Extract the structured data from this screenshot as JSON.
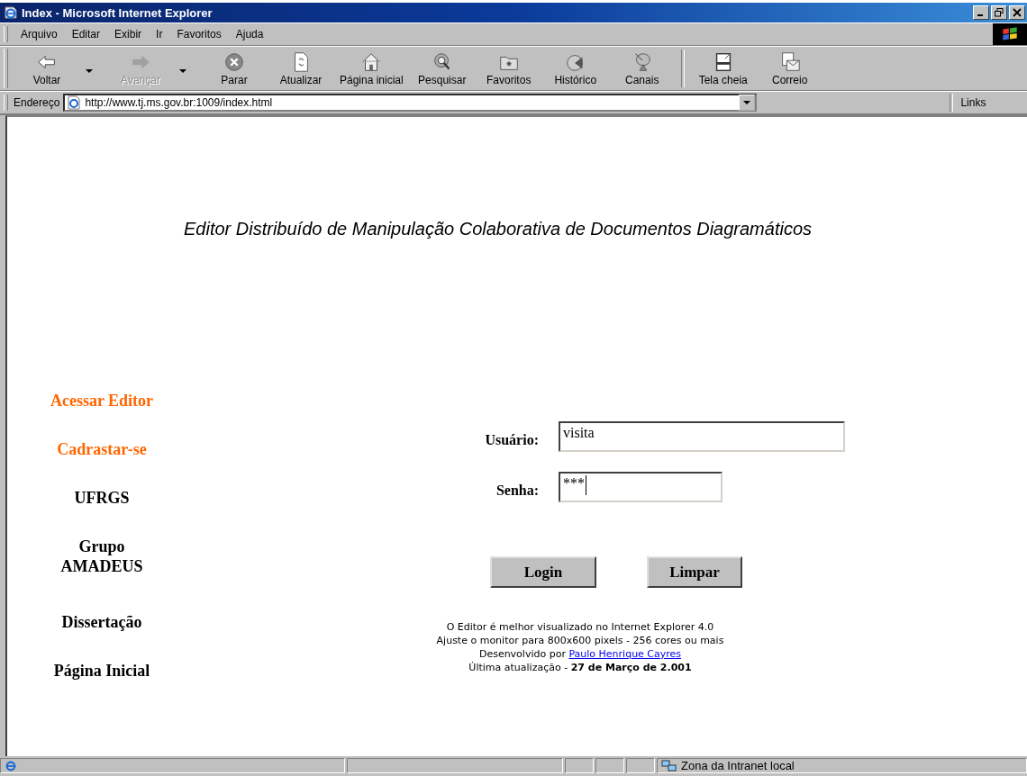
{
  "window": {
    "title": "Index - Microsoft Internet Explorer"
  },
  "menu": [
    "Arquivo",
    "Editar",
    "Exibir",
    "Ir",
    "Favoritos",
    "Ajuda"
  ],
  "toolbar": [
    {
      "label": "Voltar",
      "disabled": false,
      "dropdown": true
    },
    {
      "label": "Avançar",
      "disabled": true,
      "dropdown": true
    },
    {
      "label": "Parar",
      "disabled": false,
      "dropdown": false
    },
    {
      "label": "Atualizar",
      "disabled": false,
      "dropdown": false
    },
    {
      "label": "Página inicial",
      "disabled": false,
      "dropdown": false
    },
    {
      "label": "Pesquisar",
      "disabled": false,
      "dropdown": false
    },
    {
      "label": "Favoritos",
      "disabled": false,
      "dropdown": false
    },
    {
      "label": "Histórico",
      "disabled": false,
      "dropdown": false
    },
    {
      "label": "Canais",
      "disabled": false,
      "dropdown": false
    },
    {
      "label": "Tela cheia",
      "disabled": false,
      "dropdown": false
    },
    {
      "label": "Correio",
      "disabled": false,
      "dropdown": false
    }
  ],
  "address_bar": {
    "label": "Endereço",
    "value": "http://www.tj.ms.gov.br:1009/index.html",
    "links": "Links"
  },
  "page": {
    "heading": "Editor Distribuído de Manipulação Colaborativa de Documentos Diagramáticos",
    "nav": [
      {
        "label": "Acessar Editor",
        "color": "#ff6600"
      },
      {
        "label": "Cadrastar-se",
        "color": "#ff6600"
      },
      {
        "label": "UFRGS",
        "color": "#000000"
      },
      {
        "label": "Grupo AMADEUS",
        "color": "#000000"
      },
      {
        "label": "Dissertação",
        "color": "#000000"
      },
      {
        "label": "Página Inicial",
        "color": "#000000"
      }
    ],
    "form": {
      "user_label": "Usuário:",
      "user_value": "visita",
      "password_label": "Senha:",
      "password_value": "***"
    },
    "buttons": [
      "Login",
      "Limpar"
    ],
    "footer": {
      "line_1": "O Editor é melhor visualizado no Internet Explorer 4.0",
      "line_2": "Ajuste o  monitor para 800x600 pixels - 256 cores ou mais",
      "line_3": "Desenvolvido por",
      "author_link": "Paulo Henrique Cayres",
      "line_4": "Última atualização - **27 de Março de 2.001**"
    }
  },
  "status_bar": {
    "zone": "Zona da Intranet local"
  }
}
